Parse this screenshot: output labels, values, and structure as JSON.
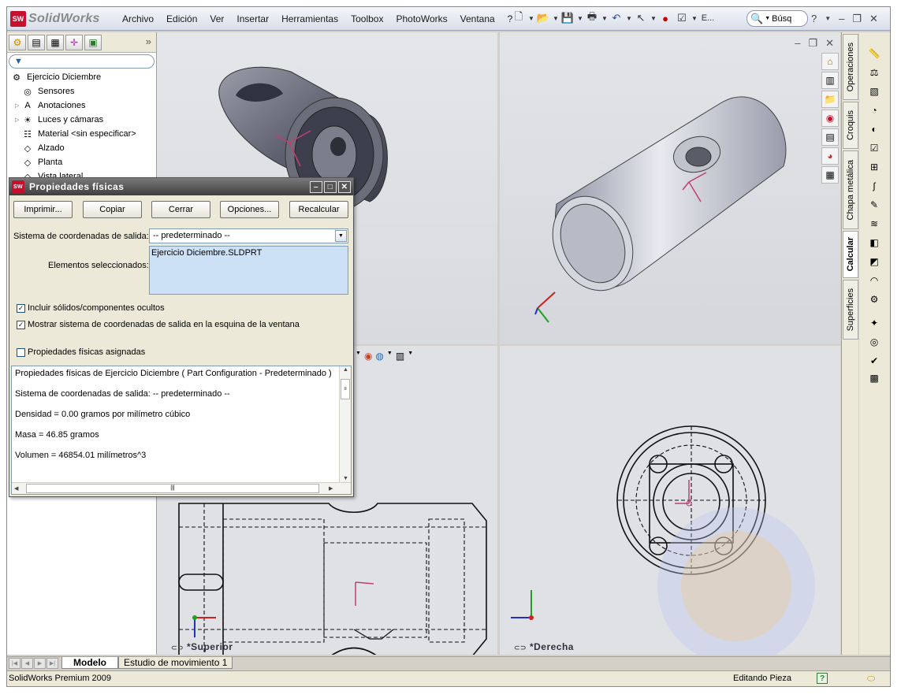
{
  "app": {
    "logo_mark": "SW",
    "logo_text": "SolidWorks"
  },
  "menu": [
    "Archivo",
    "Edición",
    "Ver",
    "Insertar",
    "Herramientas",
    "Toolbox",
    "PhotoWorks",
    "Ventana",
    "?"
  ],
  "toolbar": {
    "search_placeholder": "Búsq",
    "more_label": "E..."
  },
  "tree": {
    "items": [
      {
        "label": "Ejercicio Diciembre",
        "icon": "part-icon",
        "expandable": false
      },
      {
        "label": "Sensores",
        "icon": "sensor-icon",
        "expandable": false
      },
      {
        "label": "Anotaciones",
        "icon": "annotation-icon",
        "expandable": true
      },
      {
        "label": "Luces y cámaras",
        "icon": "lights-icon",
        "expandable": true
      },
      {
        "label": "Material <sin especificar>",
        "icon": "material-icon",
        "expandable": false
      },
      {
        "label": "Alzado",
        "icon": "plane-icon",
        "expandable": false
      },
      {
        "label": "Planta",
        "icon": "plane-icon",
        "expandable": false
      },
      {
        "label": "Vista lateral",
        "icon": "plane-icon",
        "expandable": false
      }
    ]
  },
  "dialog": {
    "title": "Propiedades físicas",
    "buttons": [
      "Imprimir...",
      "Copiar",
      "Cerrar",
      "Opciones...",
      "Recalcular"
    ],
    "coord_label": "Sistema de coordenadas de salida:",
    "coord_value": "-- predeterminado --",
    "selected_label": "Elementos seleccionados:",
    "selected_value": "Ejercicio Diciembre.SLDPRT",
    "check_hidden": "Incluir sólidos/componentes ocultos",
    "check_show_coord": "Mostrar sistema de coordenadas de salida en la esquina de la ventana",
    "check_assigned": "Propiedades físicas asignadas",
    "results": [
      "Propiedades físicas de Ejercicio Diciembre ( Part Configuration - Predeterminado )",
      "Sistema de coordenadas de salida: -- predeterminado --",
      "Densidad = 0.00 gramos por milímetro cúbico",
      "Masa = 46.85 gramos",
      "Volumen = 46854.01 milímetros^3"
    ]
  },
  "viewports": {
    "bottom_left_label": "*Superior",
    "bottom_right_label": "*Derecha"
  },
  "right_tabs": [
    "Operaciones",
    "Croquis",
    "Chapa metálica",
    "Calcular",
    "Superficies"
  ],
  "bottom_tabs": [
    "Modelo",
    "Estudio de movimiento 1"
  ],
  "status": {
    "left": "SolidWorks Premium 2009",
    "mode": "Editando Pieza",
    "help": "?"
  },
  "colors": {
    "accent": "#c8102e",
    "selection": "#cde1f6"
  }
}
